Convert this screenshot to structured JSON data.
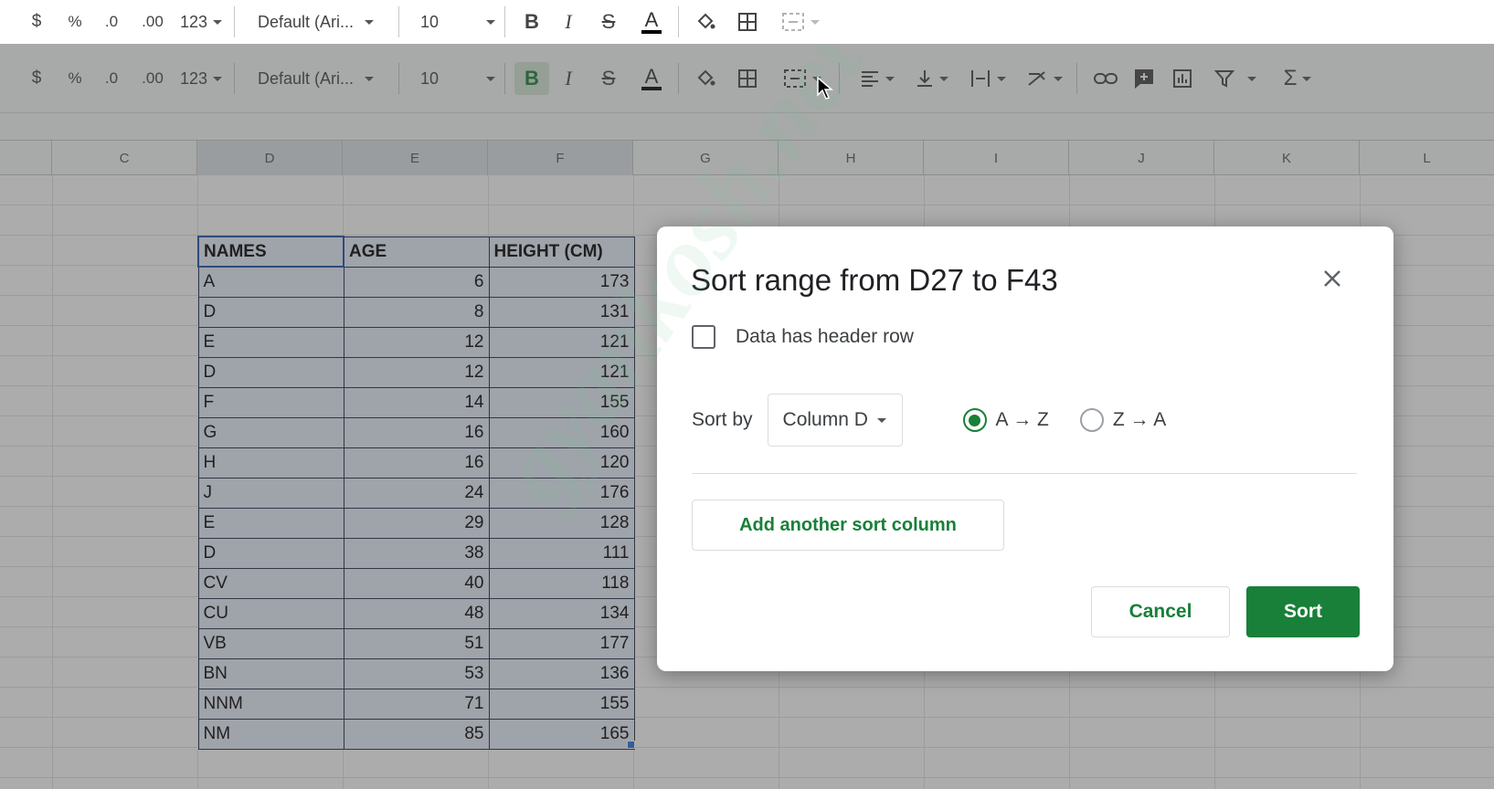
{
  "toolbar": {
    "currency": "$",
    "percent": "%",
    "dec_decrease": ".0",
    "dec_increase": ".00",
    "number_format": "123",
    "font": "Default (Ari...",
    "font_size": "10",
    "bold": "B",
    "italic": "I",
    "strike": "S",
    "text_color": "A",
    "sum": "Σ"
  },
  "columns": [
    "C",
    "D",
    "E",
    "F",
    "G",
    "H",
    "I",
    "J",
    "K",
    "L"
  ],
  "table": {
    "headers": [
      "NAMES",
      "AGE",
      "HEIGHT (CM)"
    ],
    "rows": [
      [
        "A",
        "6",
        "173"
      ],
      [
        "D",
        "8",
        "131"
      ],
      [
        "E",
        "12",
        "121"
      ],
      [
        "D",
        "12",
        "121"
      ],
      [
        "F",
        "14",
        "155"
      ],
      [
        "G",
        "16",
        "160"
      ],
      [
        "H",
        "16",
        "120"
      ],
      [
        "J",
        "24",
        "176"
      ],
      [
        "E",
        "29",
        "128"
      ],
      [
        "D",
        "38",
        "111"
      ],
      [
        "CV",
        "40",
        "118"
      ],
      [
        "CU",
        "48",
        "134"
      ],
      [
        "VB",
        "51",
        "177"
      ],
      [
        "BN",
        "53",
        "136"
      ],
      [
        "NNM",
        "71",
        "155"
      ],
      [
        "NM",
        "85",
        "165"
      ]
    ]
  },
  "dialog": {
    "title": "Sort range from D27 to F43",
    "header_row_label": "Data has header row",
    "sort_by_label": "Sort by",
    "sort_column": "Column D",
    "option_az": "A → Z",
    "option_za": "Z → A",
    "add_column_label": "Add another sort column",
    "cancel_label": "Cancel",
    "sort_label": "Sort"
  },
  "watermark": "gyankosh.net",
  "colors": {
    "accent": "#188038",
    "selection_blue": "#1a73e8"
  }
}
